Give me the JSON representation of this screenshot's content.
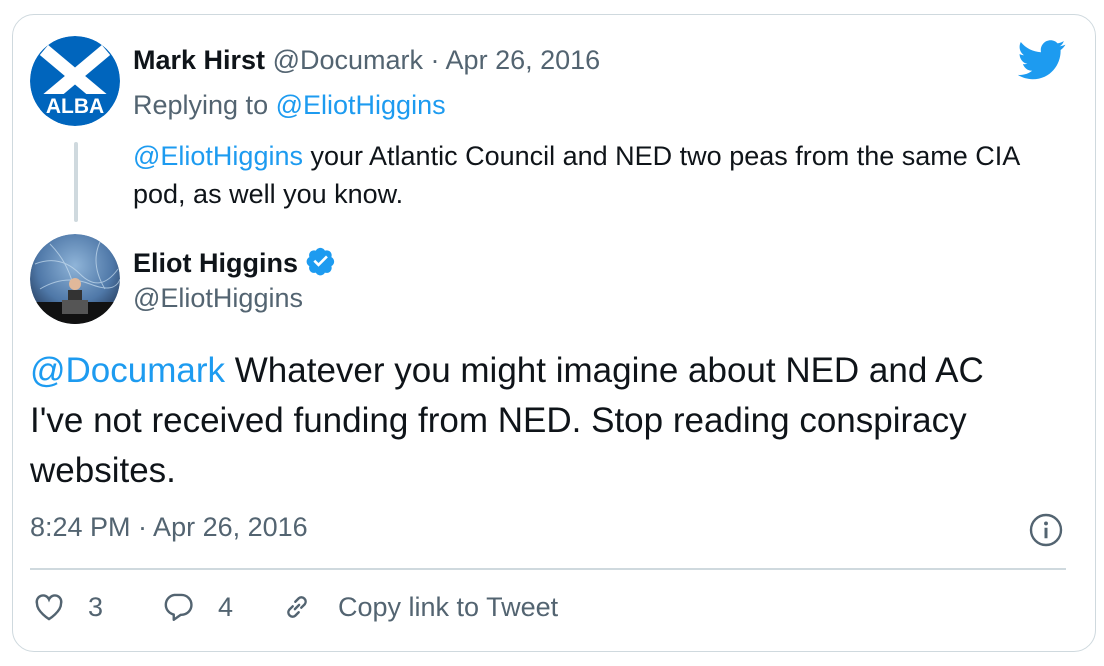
{
  "quoted_tweet": {
    "author_name": "Mark Hirst",
    "author_handle": "@Documark",
    "separator": "·",
    "date": "Apr 26, 2016",
    "avatar_text": "ALBA",
    "replying_to_label": "Replying to",
    "replying_to_handle": "@EliotHiggins",
    "mention": "@EliotHiggins",
    "text": "your Atlantic Council and NED two peas from the same CIA pod, as well you know."
  },
  "main_tweet": {
    "author_name": "Eliot Higgins",
    "author_handle": "@EliotHiggins",
    "verified": true,
    "mention": "@Documark",
    "text": "Whatever you might imagine about NED and AC I've not received funding from NED. Stop reading conspiracy websites.",
    "timestamp": "8:24 PM · Apr 26, 2016"
  },
  "actions": {
    "like_count": "3",
    "reply_count": "4",
    "copy_link_label": "Copy link to Tweet"
  },
  "colors": {
    "accent": "#1d9bf0",
    "muted": "#536471",
    "border": "#cfd9de",
    "alba_blue": "#0065bd"
  },
  "icons": [
    "twitter-bird-icon",
    "verified-badge-icon",
    "info-icon",
    "heart-icon",
    "reply-bubble-icon",
    "link-icon"
  ]
}
